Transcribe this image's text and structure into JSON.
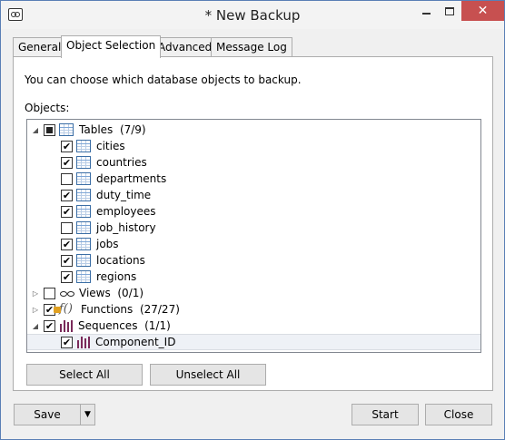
{
  "window": {
    "title": "* New Backup"
  },
  "tabs": [
    {
      "label": "General"
    },
    {
      "label": "Object Selection"
    },
    {
      "label": "Advanced"
    },
    {
      "label": "Message Log"
    }
  ],
  "panel": {
    "description": "You can choose which database objects to backup.",
    "objects_label": "Objects:"
  },
  "tree": {
    "tables": {
      "label": "Tables",
      "count": "(7/9)",
      "items": [
        {
          "label": "cities",
          "checked": true
        },
        {
          "label": "countries",
          "checked": true
        },
        {
          "label": "departments",
          "checked": false
        },
        {
          "label": "duty_time",
          "checked": true
        },
        {
          "label": "employees",
          "checked": true
        },
        {
          "label": "job_history",
          "checked": false
        },
        {
          "label": "jobs",
          "checked": true
        },
        {
          "label": "locations",
          "checked": true
        },
        {
          "label": "regions",
          "checked": true
        }
      ]
    },
    "views": {
      "label": "Views",
      "count": "(0/1)"
    },
    "functions": {
      "label": "Functions",
      "count": "(27/27)",
      "icon_text": "f()"
    },
    "sequences": {
      "label": "Sequences",
      "count": "(1/1)",
      "items": [
        {
          "label": "Component_ID",
          "checked": true
        }
      ]
    }
  },
  "buttons": {
    "select_all": "Select All",
    "unselect_all": "Unselect All",
    "save": "Save",
    "start": "Start",
    "close": "Close"
  },
  "glyphs": {
    "check": "✔",
    "expanded": "◢",
    "collapsed": "▷",
    "close_x": "✕",
    "dropdown": "▼"
  }
}
